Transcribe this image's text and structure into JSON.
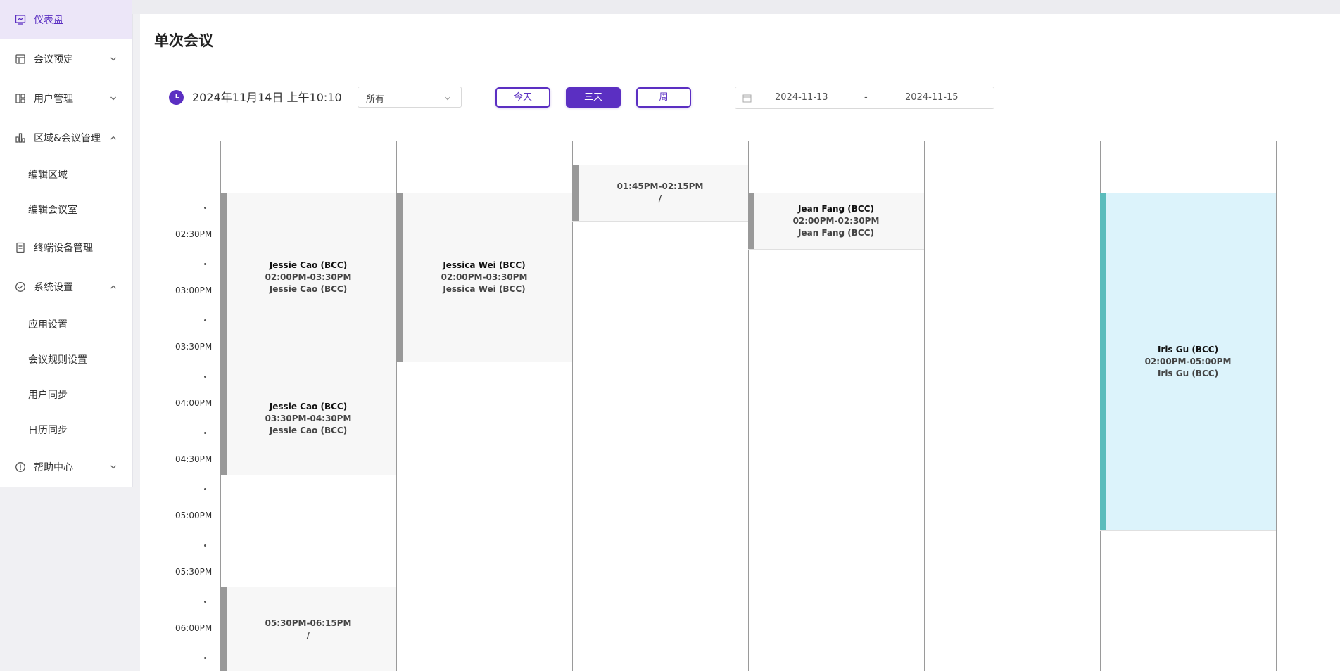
{
  "sidebar": {
    "items": [
      {
        "label": "仪表盘",
        "icon": "dashboard-icon"
      },
      {
        "label": "会议预定",
        "icon": "calendar-booking-icon"
      },
      {
        "label": "用户管理",
        "icon": "users-grid-icon"
      },
      {
        "label": "区域&会议管理",
        "icon": "bar-chart-icon"
      },
      {
        "label": "终端设备管理",
        "icon": "document-icon"
      },
      {
        "label": "系统设置",
        "icon": "check-circle-icon"
      },
      {
        "label": "帮助中心",
        "icon": "info-circle-icon"
      }
    ],
    "region_sub": [
      "编辑区域",
      "编辑会议室"
    ],
    "settings_sub": [
      "应用设置",
      "会议规则设置",
      "用户同步",
      "日历同步"
    ]
  },
  "page": {
    "title": "单次会议"
  },
  "toolbar": {
    "datetime": "2024年11月14日 上午10:10",
    "filter_value": "所有",
    "today_label": "今天",
    "three_days_label": "三天",
    "week_label": "周",
    "date_start": "2024-11-13",
    "date_separator": "-",
    "date_end": "2024-11-15"
  },
  "time_labels": [
    "02:30PM",
    "03:00PM",
    "03:30PM",
    "04:00PM",
    "04:30PM",
    "05:00PM",
    "05:30PM",
    "06:00PM"
  ],
  "events": [
    {
      "title": "Jessie Cao (BCC)",
      "time": "02:00PM-03:30PM",
      "host": "Jessie Cao (BCC)"
    },
    {
      "title": "Jessie Cao (BCC)",
      "time": "03:30PM-04:30PM",
      "host": "Jessie Cao (BCC)"
    },
    {
      "title": "",
      "time": "05:30PM-06:15PM",
      "host": "/"
    },
    {
      "title": "Jessica Wei (BCC)",
      "time": "02:00PM-03:30PM",
      "host": "Jessica Wei (BCC)"
    },
    {
      "title": "",
      "time": "01:45PM-02:15PM",
      "host": "/"
    },
    {
      "title": "Jean Fang (BCC)",
      "time": "02:00PM-02:30PM",
      "host": "Jean Fang (BCC)"
    },
    {
      "title": "Iris Gu (BCC)",
      "time": "02:00PM-05:00PM",
      "host": "Iris Gu (BCC)"
    }
  ],
  "colors": {
    "accent": "#5b2fc2",
    "active_bg": "#ece6f8",
    "teal": "#5bbcbc",
    "event_bg": "#f7f7f7",
    "teal_bg": "#dcf3fb"
  }
}
